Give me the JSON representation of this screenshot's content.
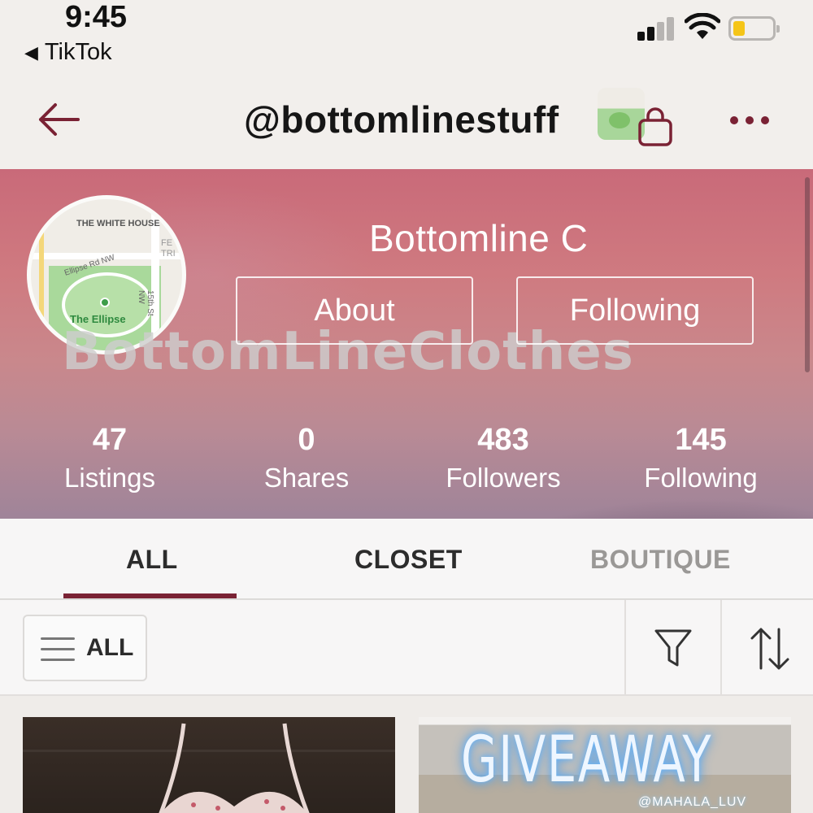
{
  "status_bar": {
    "time": "9:45",
    "back_app": "TikTok",
    "battery_color": "#f5c518"
  },
  "header": {
    "handle": "@bottomlinestuff",
    "back_icon": "arrow-left-icon",
    "shop_icon": "shopping-bag-icon",
    "more_icon": "more-dots-icon",
    "accent_color": "#7a2234"
  },
  "profile": {
    "display_name": "Bottomline C",
    "about_label": "About",
    "following_label": "Following",
    "watermark": "BottomLineClothes",
    "avatar_map": {
      "white_house": "THE WHITE HOUSE",
      "road": "Ellipse Rd NW",
      "street": "15th St NW",
      "park": "The Ellipse",
      "edge_text": "FE TRI"
    },
    "stats": [
      {
        "value": "47",
        "label": "Listings"
      },
      {
        "value": "0",
        "label": "Shares"
      },
      {
        "value": "483",
        "label": "Followers"
      },
      {
        "value": "145",
        "label": "Following"
      }
    ]
  },
  "tabs": [
    {
      "label": "ALL",
      "active": true
    },
    {
      "label": "CLOSET",
      "active": false
    },
    {
      "label": "BOUTIQUE",
      "active": false
    }
  ],
  "filter_bar": {
    "dropdown_label": "ALL",
    "menu_icon": "hamburger-icon",
    "filter_icon": "funnel-icon",
    "sort_icon": "sort-arrows-icon"
  },
  "listings": [
    {
      "image": "floral-top-photo"
    },
    {
      "image": "giveaway-photo",
      "overlay_text": "GIVEAWAY",
      "overlay_handle": "@MAHALA_LUV"
    }
  ]
}
